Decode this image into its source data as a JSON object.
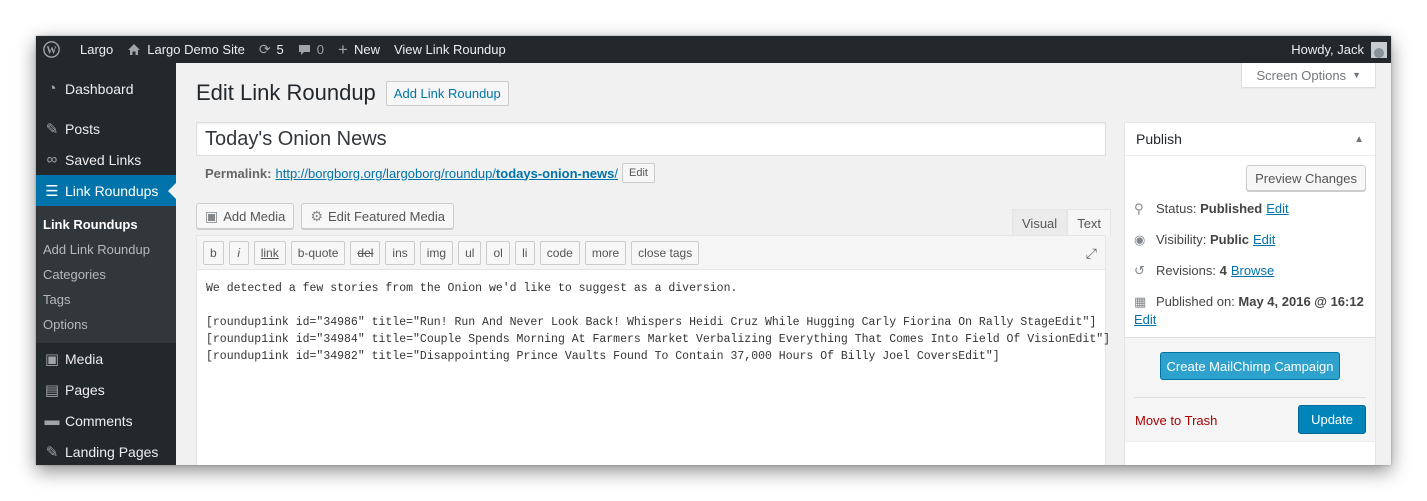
{
  "adminbar": {
    "site": "Largo",
    "demo_site": "Largo Demo Site",
    "updates_count": "5",
    "comments_count": "0",
    "new_label": "New",
    "view_label": "View Link Roundup",
    "howdy": "Howdy, Jack"
  },
  "sidebar": {
    "items": [
      {
        "label": "Dashboard",
        "icon": "dashboard-icon"
      },
      {
        "label": "Posts",
        "icon": "pin-icon"
      },
      {
        "label": "Saved Links",
        "icon": "link-icon"
      },
      {
        "label": "Link Roundups",
        "icon": "list-icon"
      }
    ],
    "submenu": [
      "Link Roundups",
      "Add Link Roundup",
      "Categories",
      "Tags",
      "Options"
    ],
    "items_after": [
      {
        "label": "Media",
        "icon": "media-icon"
      },
      {
        "label": "Pages",
        "icon": "pages-icon"
      },
      {
        "label": "Comments",
        "icon": "comment-icon"
      },
      {
        "label": "Landing Pages",
        "icon": "pin-icon"
      }
    ]
  },
  "screen_options": "Screen Options",
  "header": {
    "title": "Edit Link Roundup",
    "add_new": "Add Link Roundup"
  },
  "post": {
    "title": "Today's Onion News",
    "permalink_label": "Permalink:",
    "permalink_base": "http://borgborg.org/largoborg/roundup/",
    "permalink_slug": "todays-onion-news",
    "permalink_trailing": "/",
    "permalink_edit": "Edit"
  },
  "media_buttons": {
    "add_media": "Add Media",
    "edit_featured": "Edit Featured Media"
  },
  "editor_tabs": {
    "visual": "Visual",
    "text": "Text"
  },
  "quicktags": [
    "b",
    "i",
    "link",
    "b-quote",
    "del",
    "ins",
    "img",
    "ul",
    "ol",
    "li",
    "code",
    "more",
    "close tags"
  ],
  "editor": {
    "lines": [
      "We detected a few stories from the Onion we'd like to suggest as a diversion.",
      "",
      "[roundup1ink id=\"34986\" title=\"Run! Run And Never Look Back! Whispers Heidi Cruz While Hugging Carly Fiorina On Rally StageEdit\"]",
      "[roundup1ink id=\"34984\" title=\"Couple Spends Morning At Farmers Market Verbalizing Everything That Comes Into Field Of VisionEdit\"]",
      "[roundup1ink id=\"34982\" title=\"Disappointing Prince Vaults Found To Contain 37,000 Hours Of Billy Joel CoversEdit\"]"
    ]
  },
  "publish": {
    "title": "Publish",
    "preview": "Preview Changes",
    "status_label": "Status:",
    "status_value": "Published",
    "visibility_label": "Visibility:",
    "visibility_value": "Public",
    "revisions_label": "Revisions:",
    "revisions_value": "4",
    "browse": "Browse",
    "published_label": "Published on:",
    "published_value": "May 4, 2016 @ 16:12",
    "edit": "Edit",
    "mailchimp": "Create MailChimp Campaign",
    "trash": "Move to Trash",
    "update": "Update"
  },
  "colors": {
    "adminbar": "#23282d",
    "active_menu": "#0073aa",
    "link": "#0073aa",
    "primary_button": "#0085ba",
    "mailchimp_button": "#2ea2cc",
    "trash": "#aa0000"
  }
}
